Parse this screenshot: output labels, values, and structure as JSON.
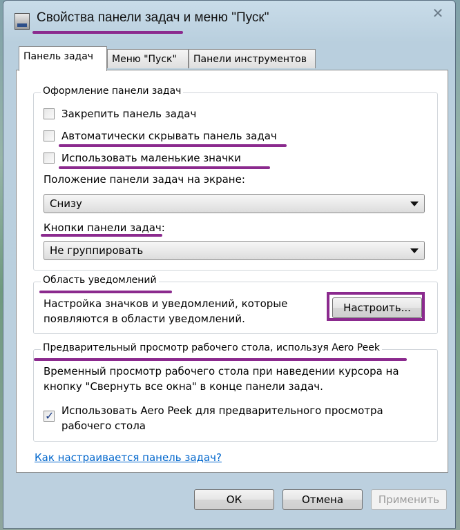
{
  "window": {
    "title": "Свойства панели задач и меню \"Пуск\"",
    "close_glyph": "✕"
  },
  "tabs": [
    {
      "label": "Панель задач",
      "active": true
    },
    {
      "label": "Меню \"Пуск\"",
      "active": false
    },
    {
      "label": "Панели инструментов",
      "active": false
    }
  ],
  "taskbar_group": {
    "title": "Оформление панели задач",
    "lock_label": "Закрепить панель задач",
    "lock_checked": false,
    "autohide_label": "Автоматически скрывать панель задач",
    "autohide_checked": false,
    "small_icons_label": "Использовать маленькие значки",
    "small_icons_checked": false,
    "position_label": "Положение панели задач на экране:",
    "position_value": "Снизу",
    "buttons_label": "Кнопки панели задач:",
    "buttons_value": "Не группировать"
  },
  "notification_group": {
    "title": "Область уведомлений",
    "description_line1": "Настройка значков и уведомлений, которые",
    "description_line2": "появляются в области уведомлений.",
    "customize_button": "Настроить..."
  },
  "aero_group": {
    "title": "Предварительный просмотр рабочего стола, используя Aero Peek",
    "description_line1": "Временный просмотр рабочего стола при наведении курсора на",
    "description_line2": "кнопку \"Свернуть все окна\" в конце панели задач.",
    "checkbox_line1": "Использовать Aero Peek для предварительного просмотра",
    "checkbox_line2": "рабочего стола",
    "checkbox_checked": true
  },
  "help_link": "Как настраивается панель задач?",
  "footer": {
    "ok": "ОК",
    "cancel": "Отмена",
    "apply": "Применить"
  },
  "colors": {
    "highlight": "#8b2a8e",
    "link": "#0066cc"
  }
}
